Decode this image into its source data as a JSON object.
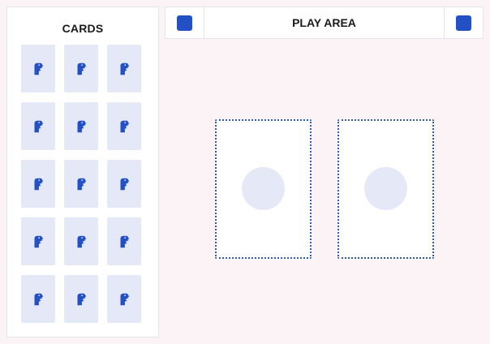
{
  "sidebar": {
    "title": "CARDS",
    "cards": [
      {
        "icon": "dinosaur-head-icon"
      },
      {
        "icon": "dinosaur-head-icon"
      },
      {
        "icon": "dinosaur-head-icon"
      },
      {
        "icon": "dinosaur-head-icon"
      },
      {
        "icon": "dinosaur-head-icon"
      },
      {
        "icon": "dinosaur-head-icon"
      },
      {
        "icon": "dinosaur-head-icon"
      },
      {
        "icon": "dinosaur-head-icon"
      },
      {
        "icon": "dinosaur-head-icon"
      },
      {
        "icon": "dinosaur-head-icon"
      },
      {
        "icon": "dinosaur-head-icon"
      },
      {
        "icon": "dinosaur-head-icon"
      },
      {
        "icon": "dinosaur-head-icon"
      },
      {
        "icon": "dinosaur-head-icon"
      },
      {
        "icon": "dinosaur-head-icon"
      }
    ]
  },
  "header": {
    "title": "PLAY AREA",
    "left_button_icon": "square-icon",
    "right_button_icon": "square-icon"
  },
  "play_area": {
    "slots": [
      {
        "state": "empty"
      },
      {
        "state": "empty"
      }
    ]
  },
  "colors": {
    "accent": "#2350c4",
    "card_back": "#e4e8f7",
    "page_background": "#fcf3f6",
    "slot_border": "#2f5bbf"
  }
}
